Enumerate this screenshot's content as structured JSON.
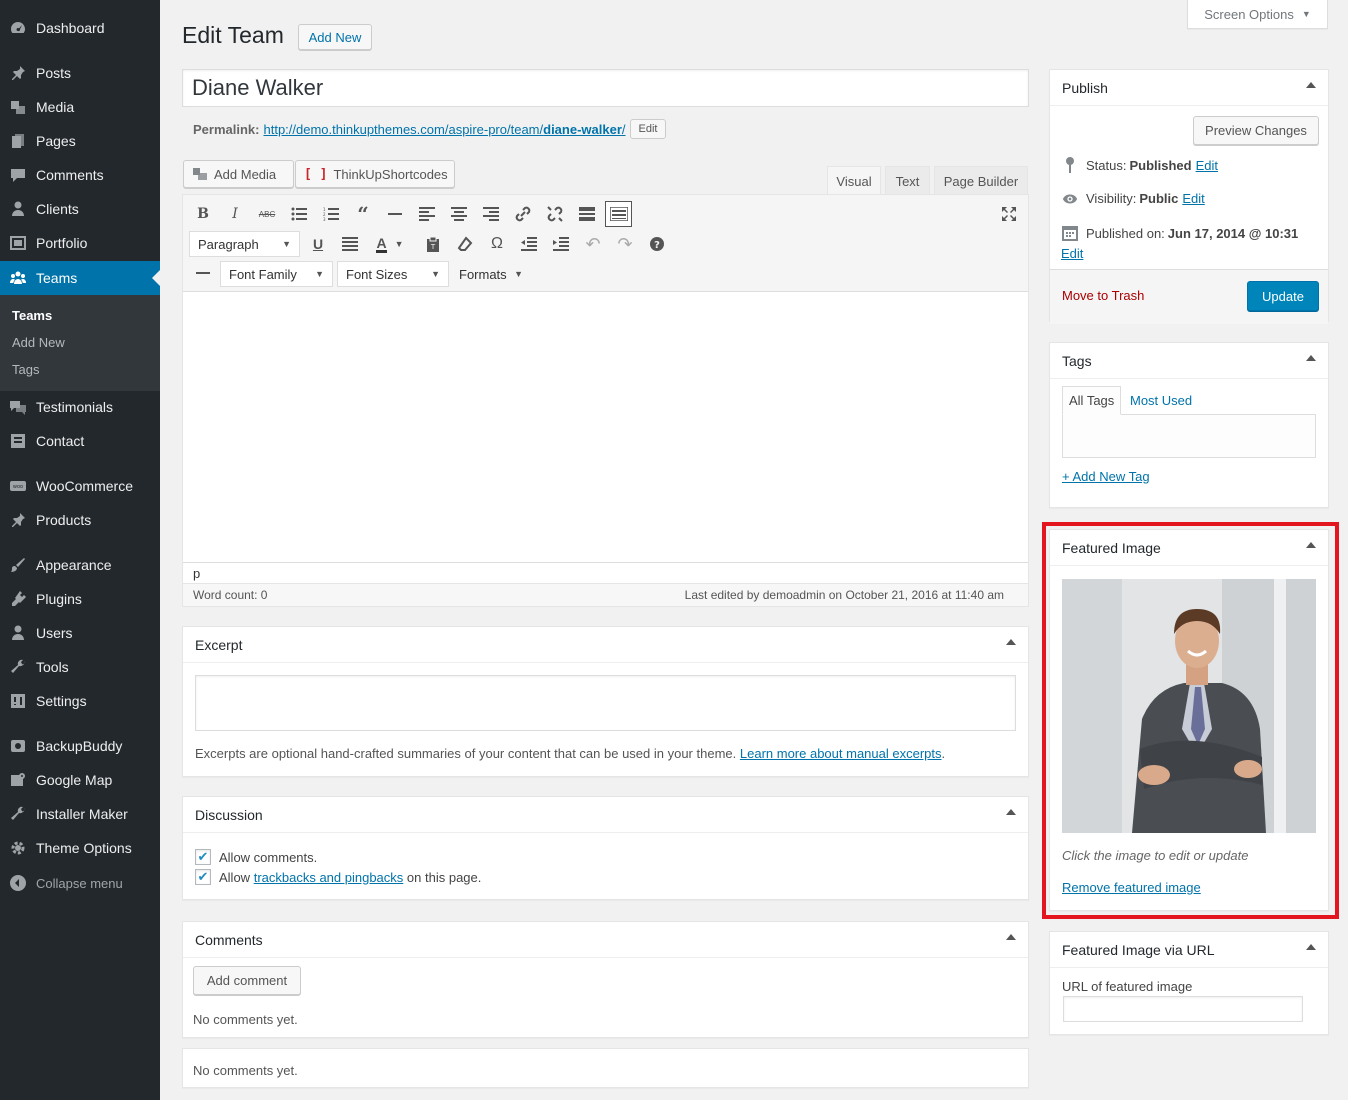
{
  "sidebar": {
    "items": [
      {
        "label": "Dashboard",
        "icon": "dashboard-icon"
      },
      {
        "label": "Posts",
        "icon": "pin-icon"
      },
      {
        "label": "Media",
        "icon": "media-icon"
      },
      {
        "label": "Pages",
        "icon": "pages-icon"
      },
      {
        "label": "Comments",
        "icon": "comment-icon"
      },
      {
        "label": "Clients",
        "icon": "user-icon"
      },
      {
        "label": "Portfolio",
        "icon": "portfolio-icon"
      },
      {
        "label": "Teams",
        "icon": "groups-icon"
      },
      {
        "label": "Testimonials",
        "icon": "testimonial-icon"
      },
      {
        "label": "Contact",
        "icon": "contact-icon"
      },
      {
        "label": "WooCommerce",
        "icon": "woo-icon"
      },
      {
        "label": "Products",
        "icon": "pin-icon"
      },
      {
        "label": "Appearance",
        "icon": "brush-icon"
      },
      {
        "label": "Plugins",
        "icon": "plugin-icon"
      },
      {
        "label": "Users",
        "icon": "user-icon"
      },
      {
        "label": "Tools",
        "icon": "wrench-icon"
      },
      {
        "label": "Settings",
        "icon": "settings-icon"
      },
      {
        "label": "BackupBuddy",
        "icon": "backup-icon"
      },
      {
        "label": "Google Map",
        "icon": "map-icon"
      },
      {
        "label": "Installer Maker",
        "icon": "wrench-icon"
      },
      {
        "label": "Theme Options",
        "icon": "gear-icon"
      }
    ],
    "submenu": [
      "Teams",
      "Add New",
      "Tags"
    ],
    "collapse": "Collapse menu"
  },
  "header": {
    "title": "Edit Team",
    "add_new": "Add New",
    "screen_options": "Screen Options"
  },
  "post": {
    "title": "Diane Walker",
    "permalink_label": "Permalink:",
    "permalink_base": "http://demo.thinkupthemes.com/aspire-pro/team/",
    "permalink_slug": "diane-walker",
    "permalink_trail": "/",
    "permalink_edit": "Edit"
  },
  "editor": {
    "add_media": "Add Media",
    "shortcodes": "ThinkUpShortcodes",
    "tabs": [
      "Visual",
      "Text",
      "Page Builder"
    ],
    "paragraph": "Paragraph",
    "font_family": "Font Family",
    "font_sizes": "Font Sizes",
    "formats": "Formats",
    "path": "p",
    "word_count": "Word count: 0",
    "last_edited": "Last edited by demoadmin on October 21, 2016 at 11:40 am"
  },
  "excerpt": {
    "title": "Excerpt",
    "help": "Excerpts are optional hand-crafted summaries of your content that can be used in your theme.",
    "help_link": "Learn more about manual excerpts",
    "help_end": "."
  },
  "discussion": {
    "title": "Discussion",
    "allow_comments": "Allow comments.",
    "allow_track_pre": "Allow",
    "allow_track_link": "trackbacks and pingbacks",
    "allow_track_post": "on this page."
  },
  "comments": {
    "title": "Comments",
    "add_comment": "Add comment",
    "none": "No comments yet."
  },
  "extra_box": {
    "none": "No comments yet."
  },
  "publish": {
    "title": "Publish",
    "preview": "Preview Changes",
    "status_label": "Status:",
    "status_value": "Published",
    "visibility_label": "Visibility:",
    "visibility_value": "Public",
    "published_label": "Published on:",
    "published_value": "Jun 17, 2014 @ 10:31",
    "edit": "Edit",
    "trash": "Move to Trash",
    "update": "Update"
  },
  "tags": {
    "title": "Tags",
    "tab_all": "All Tags",
    "tab_most": "Most Used",
    "add_new": "+ Add New Tag"
  },
  "featured": {
    "title": "Featured Image",
    "hint": "Click the image to edit or update",
    "remove": "Remove featured image"
  },
  "featured_url": {
    "title": "Featured Image via URL",
    "label": "URL of featured image"
  },
  "colors": {
    "sidebar_bg": "#23282d",
    "accent": "#0073aa",
    "button_primary": "#0085ba",
    "highlight": "#e3161f",
    "trash": "#aa0000"
  }
}
